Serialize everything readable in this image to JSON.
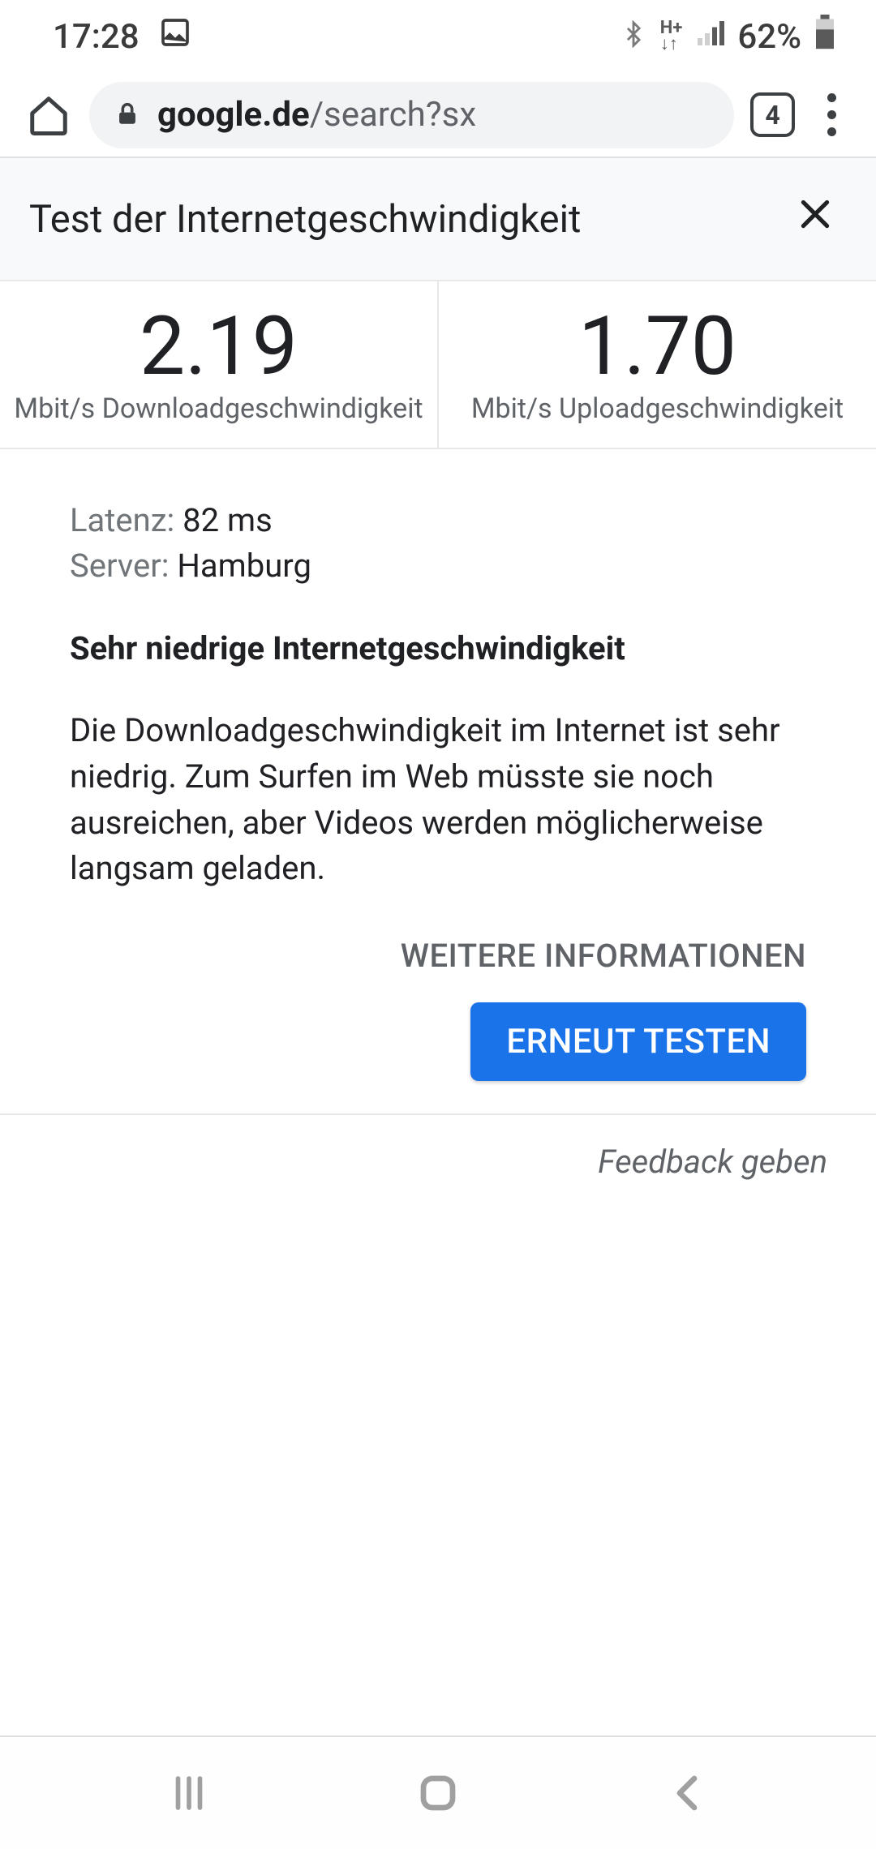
{
  "status": {
    "time": "17:28",
    "battery": "62%"
  },
  "browser": {
    "url_domain": "google.de",
    "url_path": "/search?sx",
    "tabs": "4"
  },
  "card": {
    "title": "Test der Internetgeschwindigkeit"
  },
  "speed": {
    "download_value": "2.19",
    "download_label": "Mbit/s Downloadgeschwindigkeit",
    "upload_value": "1.70",
    "upload_label": "Mbit/s Uploadgeschwindigkeit"
  },
  "info": {
    "latency_label": "Latenz: ",
    "latency_value": "82 ms",
    "server_label": "Server: ",
    "server_value": "Hamburg",
    "assess_title": "Sehr niedrige Internetgeschwindigkeit",
    "assess_body": "Die Downloadgeschwindigkeit im Internet ist sehr niedrig. Zum Surfen im Web müsste sie noch ausreichen, aber Videos werden möglicherweise langsam geladen.",
    "more_info": "WEITERE INFORMATIONEN",
    "retest": "ERNEUT TESTEN"
  },
  "feedback": "Feedback geben"
}
